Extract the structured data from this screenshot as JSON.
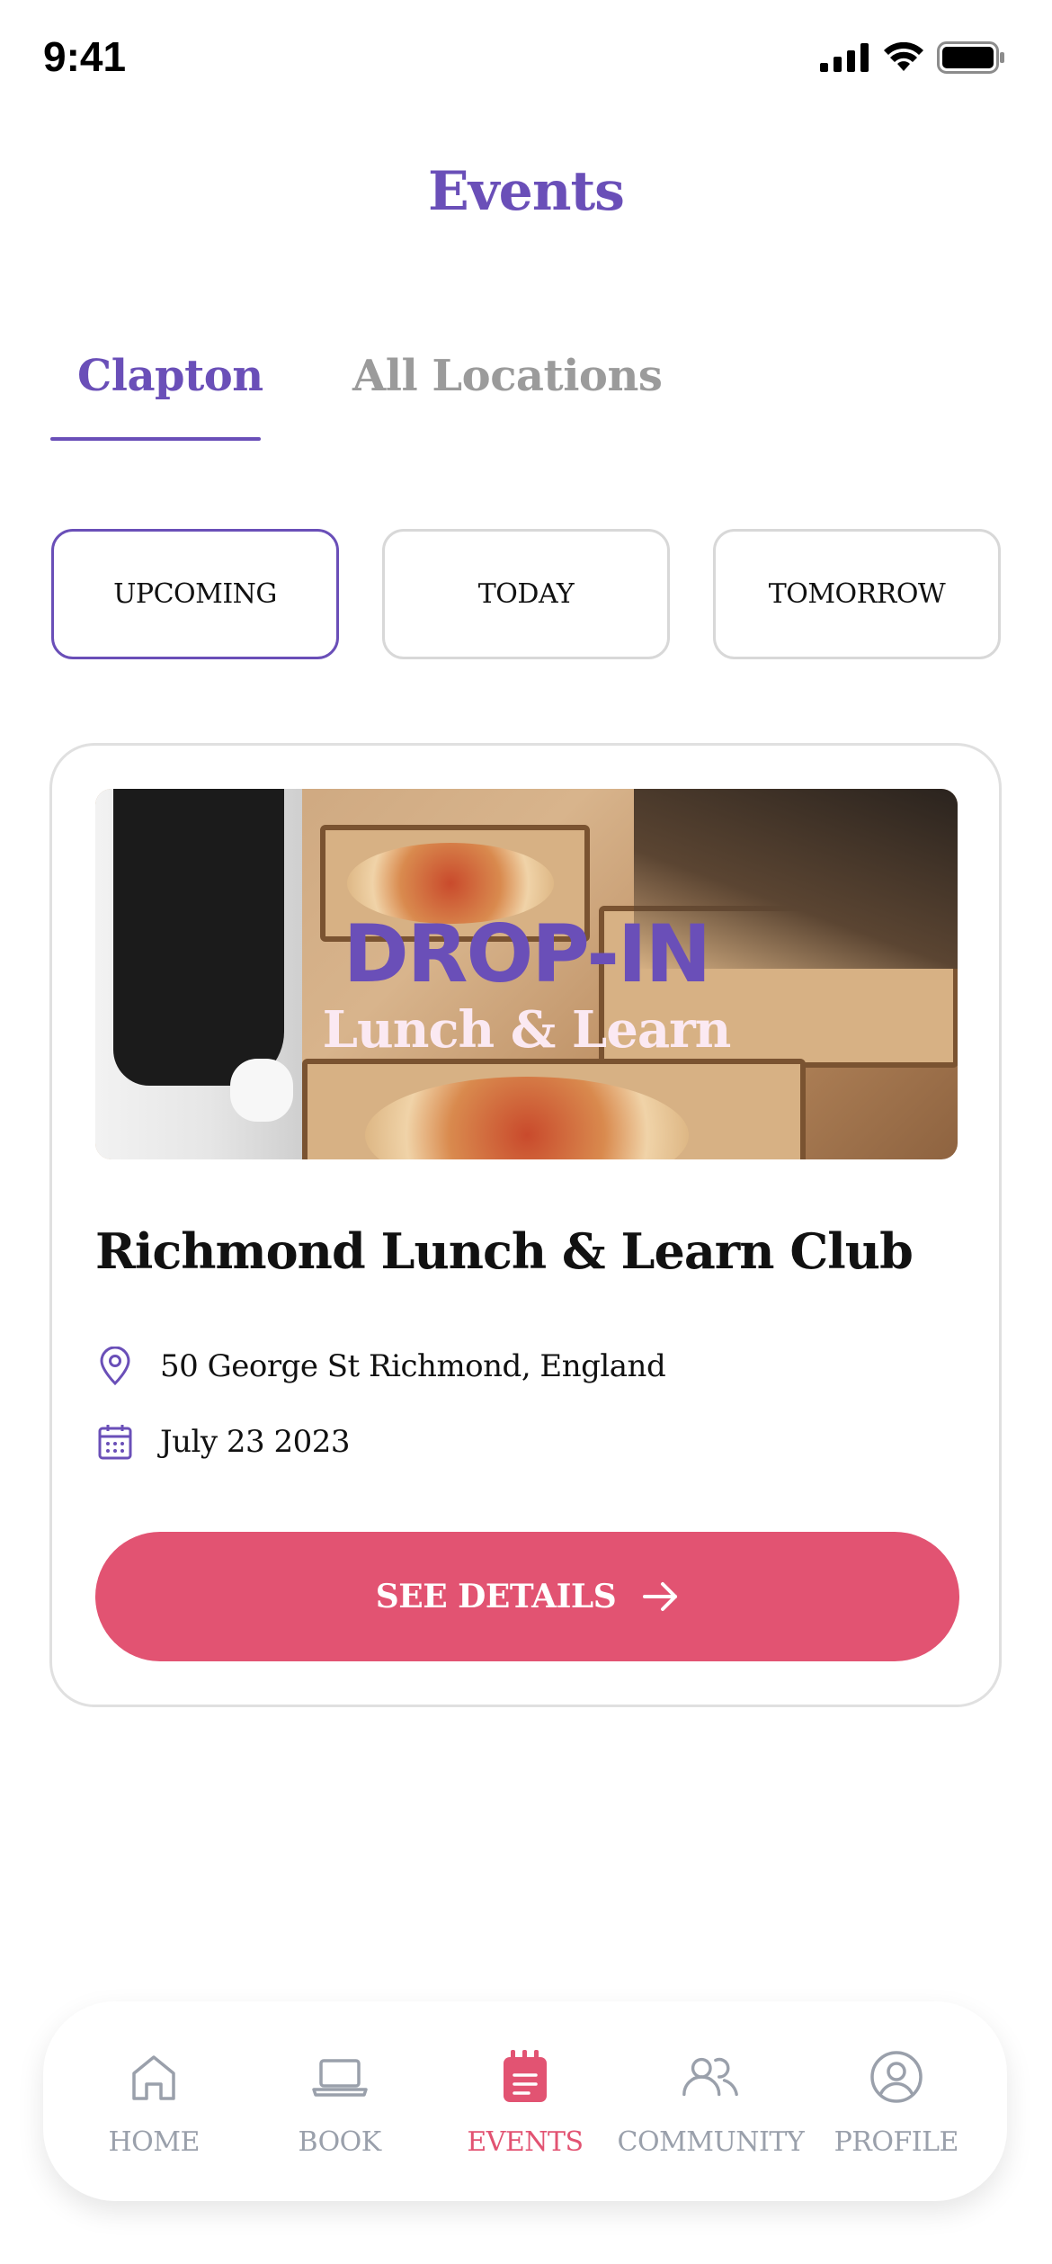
{
  "status_bar": {
    "time": "9:41"
  },
  "header": {
    "title": "Events"
  },
  "tabs": [
    {
      "label": "Clapton",
      "active": true
    },
    {
      "label": "All Locations",
      "active": false
    }
  ],
  "filters": [
    {
      "label": "UPCOMING",
      "active": true
    },
    {
      "label": "TODAY",
      "active": false
    },
    {
      "label": "TOMORROW",
      "active": false
    }
  ],
  "event_card": {
    "banner_headline": "DROP-IN",
    "banner_subtitle": "Lunch & Learn",
    "title": "Richmond Lunch & Learn Club",
    "location": "50 George St Richmond, England",
    "date": "July 23 2023",
    "cta_label": "SEE DETAILS"
  },
  "bottom_nav": [
    {
      "label": "HOME",
      "icon": "home-icon",
      "active": false
    },
    {
      "label": "BOOK",
      "icon": "laptop-icon",
      "active": false
    },
    {
      "label": "EVENTS",
      "icon": "events-icon",
      "active": true
    },
    {
      "label": "COMMUNITY",
      "icon": "community-icon",
      "active": false
    },
    {
      "label": "PROFILE",
      "icon": "profile-icon",
      "active": false
    }
  ],
  "colors": {
    "accent": "#6a4fb8",
    "cta": "#e25372",
    "inactive": "#9aa0ab"
  }
}
